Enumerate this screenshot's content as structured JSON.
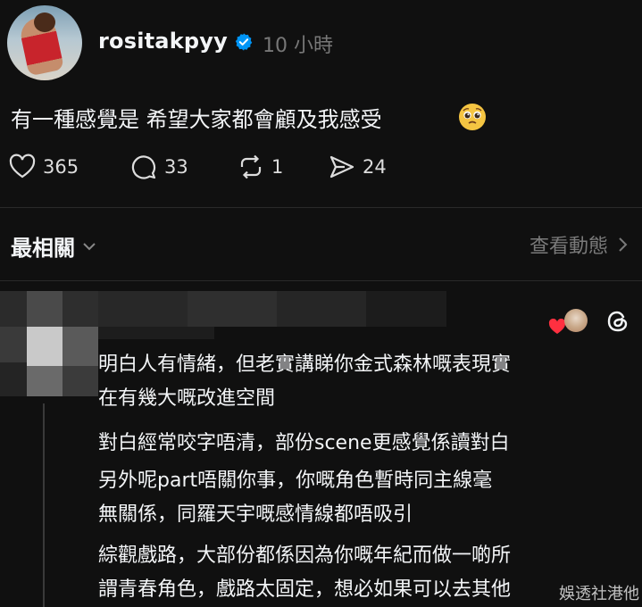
{
  "post": {
    "username": "rositakpyy",
    "time": "10 小時",
    "text": "有一種感覺是 希望大家都會顧及我感受",
    "emoji": "pleading-face-emoji",
    "likes": "365",
    "comments": "33",
    "reposts": "1",
    "shares": "24"
  },
  "sort": {
    "label": "最相關",
    "activity_label": "查看動態"
  },
  "reply": {
    "lines": [
      "明白人有情緒，但老實講睇你金式森林嘅表現實",
      "在有幾大嘅改進空間",
      "對白經常咬字唔清，部份scene更感覺係讀對白",
      "另外呢part唔關你事，你嘅角色暫時同主線毫",
      "無關係，同羅天宇嘅感情線都唔吸引",
      "綜觀戲路，大部份都係因為你嘅年紀而做一啲所",
      "謂青春角色，戲路太固定，想必如果可以去其他"
    ]
  },
  "watermark": "娛透社港他",
  "colors": {
    "background": "#101010",
    "text": "#f3f5f7",
    "muted": "#777777",
    "verified": "#0095f6",
    "heart": "#ff3040"
  }
}
